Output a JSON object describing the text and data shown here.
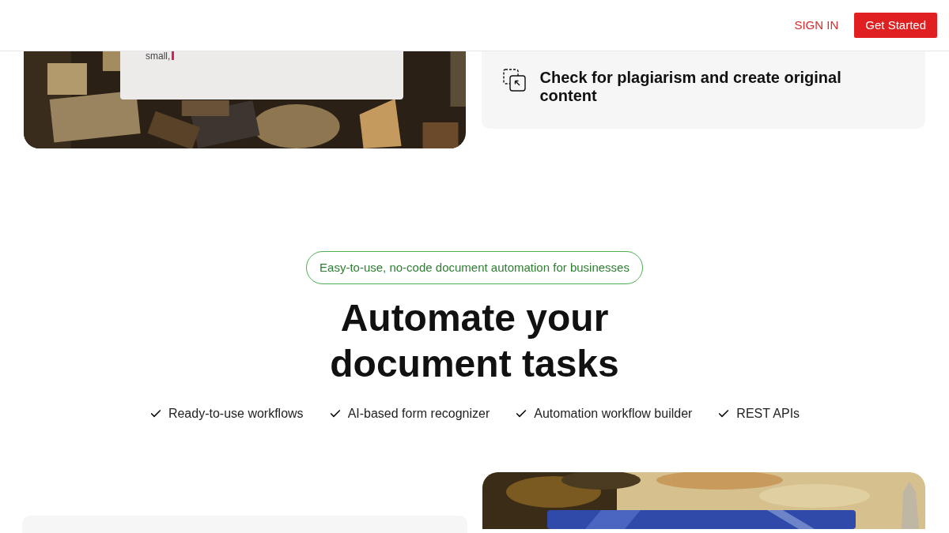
{
  "header": {
    "sign_in": "SIGN IN",
    "cta": "Get Started"
  },
  "top_section": {
    "editor_text": "small,",
    "feature": "Check for plagiarism and create original content"
  },
  "hero": {
    "badge": "Easy-to-use, no-code document automation for businesses",
    "title_lines": [
      "Automate your",
      "document tasks"
    ],
    "features": [
      "Ready-to-use workflows",
      "AI-based form recognizer",
      "Automation workflow builder",
      "REST APIs"
    ]
  }
}
